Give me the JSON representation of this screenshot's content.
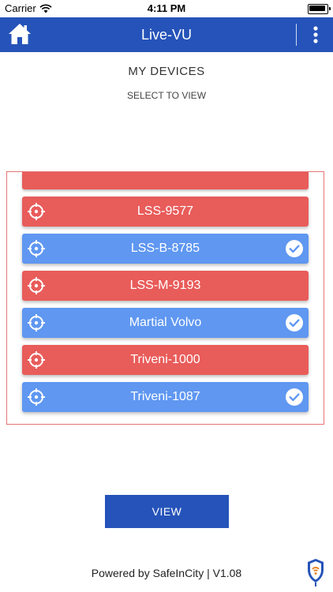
{
  "status_bar": {
    "carrier": "Carrier",
    "time": "4:11 PM"
  },
  "nav": {
    "title": "Live-VU",
    "home_icon": "home-icon",
    "menu_icon": "vertical-dots-menu-icon"
  },
  "page": {
    "heading": "MY DEVICES",
    "subheading": "SELECT TO VIEW"
  },
  "colors": {
    "nav_blue": "#2553b9",
    "row_red": "#e85c5a",
    "row_blue": "#5f97f1",
    "frame_border": "#e57373"
  },
  "devices": [
    {
      "name": "LSS-9577",
      "status": "offline",
      "selected": false
    },
    {
      "name": "LSS-B-8785",
      "status": "online",
      "selected": true
    },
    {
      "name": "LSS-M-9193",
      "status": "offline",
      "selected": false
    },
    {
      "name": "Martial Volvo",
      "status": "online",
      "selected": true
    },
    {
      "name": "Triveni-1000",
      "status": "offline",
      "selected": false
    },
    {
      "name": "Triveni-1087",
      "status": "online",
      "selected": true
    }
  ],
  "actions": {
    "view_label": "VIEW"
  },
  "footer": {
    "powered_by": "Powered by SafeInCity | V1.08"
  }
}
